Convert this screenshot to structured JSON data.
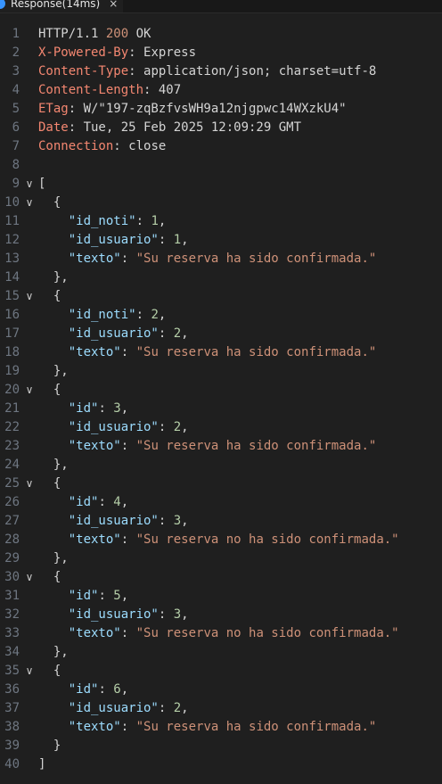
{
  "tab": {
    "label": "Response(14ms)",
    "close": "×",
    "icon": "request-dot-icon"
  },
  "colors": {
    "background": "#1f1f1f",
    "header_key": "#f48771",
    "json_key": "#9cdcfe",
    "json_string": "#ce9178",
    "json_number": "#b5cea8",
    "line_number": "#6e7681"
  },
  "http": {
    "protocol": "HTTP/1.1",
    "status_code": "200",
    "status_text": "OK",
    "headers": [
      {
        "name": "X-Powered-By",
        "value": "Express"
      },
      {
        "name": "Content-Type",
        "value": "application/json; charset=utf-8"
      },
      {
        "name": "Content-Length",
        "value": "407"
      },
      {
        "name": "ETag",
        "value": "W/\"197-zqBzfvsWH9a12njgpwc14WXzkU4\""
      },
      {
        "name": "Date",
        "value": "Tue, 25 Feb 2025 12:09:29 GMT"
      },
      {
        "name": "Connection",
        "value": "close"
      }
    ]
  },
  "body": [
    {
      "id_key": "id_noti",
      "id": "1",
      "id_usuario": "1",
      "texto": "Su reserva ha sido confirmada."
    },
    {
      "id_key": "id_noti",
      "id": "2",
      "id_usuario": "2",
      "texto": "Su reserva ha sido confirmada."
    },
    {
      "id_key": "id",
      "id": "3",
      "id_usuario": "2",
      "texto": "Su reserva ha sido confirmada."
    },
    {
      "id_key": "id",
      "id": "4",
      "id_usuario": "3",
      "texto": "Su reserva no ha sido confirmada."
    },
    {
      "id_key": "id",
      "id": "5",
      "id_usuario": "3",
      "texto": "Su reserva no ha sido confirmada."
    },
    {
      "id_key": "id",
      "id": "6",
      "id_usuario": "2",
      "texto": "Su reserva ha sido confirmada."
    }
  ],
  "lines": {
    "count": 40,
    "fold_marker": "∨"
  }
}
